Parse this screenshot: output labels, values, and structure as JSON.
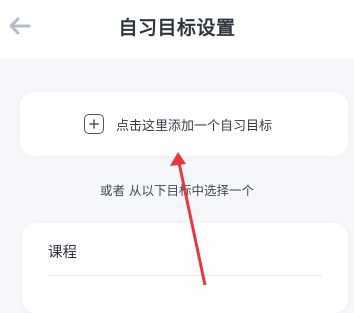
{
  "header": {
    "title": "自习目标设置",
    "back_icon": "arrow-left-icon"
  },
  "add_goal": {
    "icon": "plus-square-icon",
    "label": "点击这里添加一个自习目标"
  },
  "choose_hint": "或者 从以下目标中选择一个",
  "presets": {
    "course_label": "课程"
  },
  "annotation": {
    "icon": "red-arrow-icon",
    "color": "#e23b3b"
  },
  "colors": {
    "background": "#f5f7fa",
    "card": "#ffffff",
    "back_icon": "#b4bcc6"
  }
}
